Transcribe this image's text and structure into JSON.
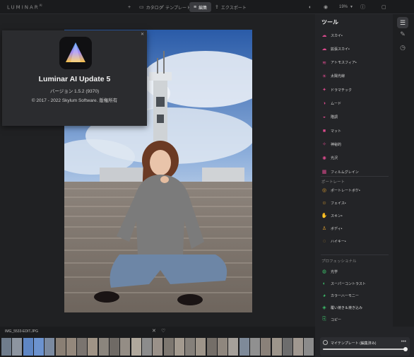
{
  "app": {
    "logo": "LUMINAR",
    "logo_sup": "AI"
  },
  "topnav": {
    "add_icon": "plus-icon",
    "catalog": "カタログ",
    "templates": "テンプレート",
    "edit": "編集",
    "export": "エクスポート"
  },
  "top_right": {
    "zoom": "19%"
  },
  "about": {
    "title": "Luminar AI Update 5",
    "version": "バージョン 1.5.2 (9370)",
    "copyright": "© 2017 - 2022 Skylum Software. 版権所有"
  },
  "tools": {
    "title": "ツール",
    "items": [
      {
        "label": "スカイ•",
        "icon": "cloud-icon",
        "color": "#d94a8c"
      },
      {
        "label": "拡張スカイ•",
        "icon": "sky-plus-icon",
        "color": "#d94a8c"
      },
      {
        "label": "アトモスフィア•",
        "icon": "fog-icon",
        "color": "#d94a8c"
      },
      {
        "label": "太陽光線",
        "icon": "sun-icon",
        "color": "#d94a8c"
      },
      {
        "label": "ドラマチック",
        "icon": "drama-icon",
        "color": "#d94a8c"
      },
      {
        "label": "ムード",
        "icon": "mood-icon",
        "color": "#d94a8c"
      },
      {
        "label": "階調",
        "icon": "toning-icon",
        "color": "#d94a8c"
      },
      {
        "label": "マット",
        "icon": "matte-icon",
        "color": "#d94a8c"
      },
      {
        "label": "神秘的",
        "icon": "mystical-icon",
        "color": "#d94a8c"
      },
      {
        "label": "光沢",
        "icon": "glow-icon",
        "color": "#d94a8c"
      },
      {
        "label": "フィルムグレイン",
        "icon": "grain-icon",
        "color": "#d94a8c"
      }
    ],
    "portrait_section": "ポートレート",
    "portrait_items": [
      {
        "label": "ポートレートボケ•",
        "icon": "bokeh-icon",
        "color": "#e0a030"
      },
      {
        "label": "フェイス•",
        "icon": "face-icon",
        "color": "#e0a030"
      },
      {
        "label": "スキン•",
        "icon": "skin-icon",
        "color": "#e0a030"
      },
      {
        "label": "ボディ•",
        "icon": "body-icon",
        "color": "#e0a030"
      },
      {
        "label": "ハイキー•",
        "icon": "highkey-icon",
        "color": "#e0a030"
      }
    ],
    "pro_section": "プロフェッショナル",
    "pro_items": [
      {
        "label": "光学",
        "icon": "optics-icon",
        "color": "#3cbf6a"
      },
      {
        "label": "スーパーコントラスト",
        "icon": "contrast-icon",
        "color": "#3cbf6a"
      },
      {
        "label": "カラーハーモニー",
        "icon": "harmony-icon",
        "color": "#3cbf6a"
      },
      {
        "label": "覆い焼き＆焼き込み",
        "icon": "dodge-icon",
        "color": "#3cbf6a"
      },
      {
        "label": "コピー",
        "icon": "clone-icon",
        "color": "#3cbf6a"
      }
    ]
  },
  "filmstrip": {
    "file_name": "IMG_5533-EDIT.JPG"
  },
  "presets": {
    "label": "マイテンプレート (編集済み)",
    "amount": 1.0
  }
}
